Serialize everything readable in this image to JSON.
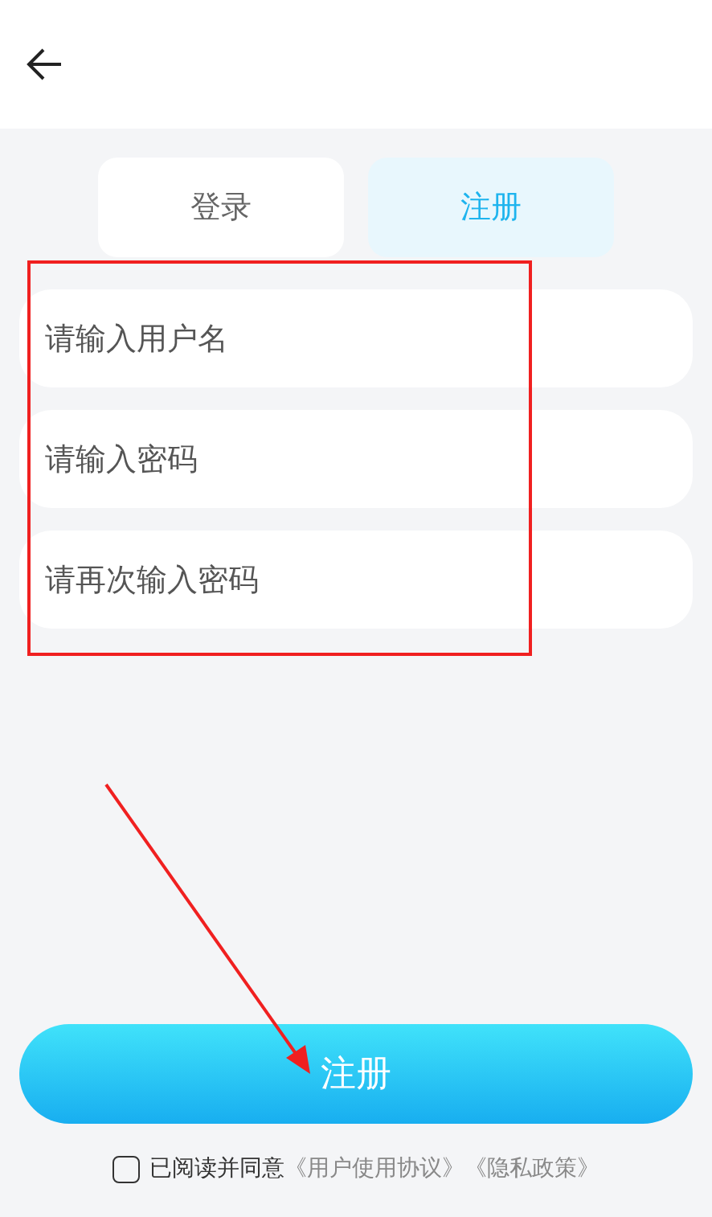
{
  "tabs": [
    {
      "label": "登录",
      "selected": false
    },
    {
      "label": "注册",
      "selected": true
    }
  ],
  "fields": [
    {
      "placeholder": "请输入用户名"
    },
    {
      "placeholder": "请输入密码"
    },
    {
      "placeholder": "请再次输入密码"
    }
  ],
  "submit_button": "注册",
  "agreement": {
    "checked": false,
    "text": "已阅读并同意",
    "links": [
      "《用户使用协议》",
      "《隐私政策》"
    ]
  }
}
